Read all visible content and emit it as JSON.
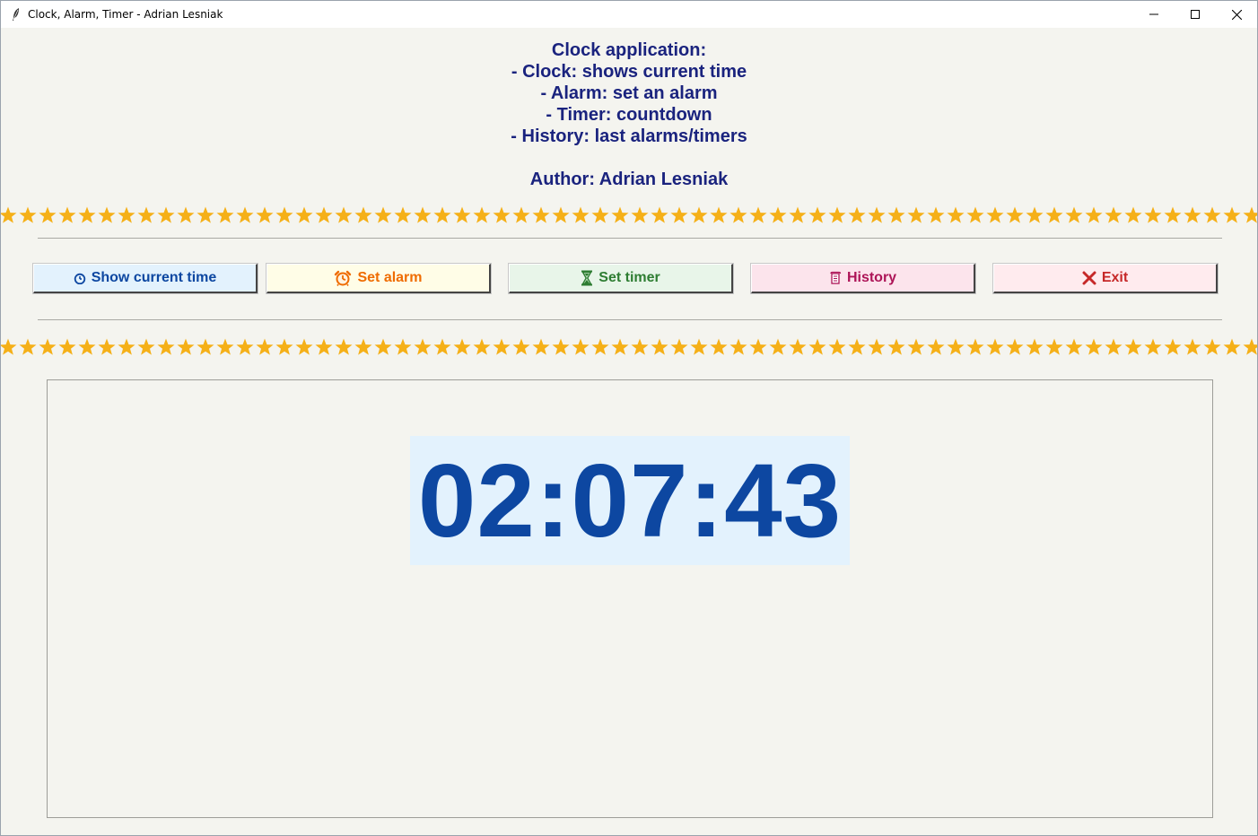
{
  "window": {
    "title": "Clock, Alarm, Timer - Adrian Lesniak",
    "app_icon": "feather-icon",
    "controls": [
      "minimize-icon",
      "maximize-icon",
      "close-icon"
    ]
  },
  "info": {
    "lines": [
      "Clock application:",
      "- Clock: shows current time",
      "- Alarm: set an alarm",
      "- Timer: countdown",
      "- History: last alarms/timers"
    ],
    "author": "Author: Adrian Lesniak"
  },
  "decoration": {
    "star_icon": "star-icon",
    "star_color": "#f5b018"
  },
  "buttons": {
    "show_time": {
      "label": "Show current time",
      "icon": "clock-icon",
      "bg": "#e3f2fd",
      "color": "#0d47a1"
    },
    "set_alarm": {
      "label": "Set alarm",
      "icon": "alarm-clock-icon",
      "bg": "#fffde7",
      "color": "#ef6c00"
    },
    "set_timer": {
      "label": "Set timer",
      "icon": "hourglass-icon",
      "bg": "#e8f5e9",
      "color": "#2e7d32"
    },
    "history": {
      "label": "History",
      "icon": "scroll-icon",
      "bg": "#fce4ec",
      "color": "#ad1457"
    },
    "exit": {
      "label": "Exit",
      "icon": "cross-icon",
      "bg": "#ffebee",
      "color": "#c62828"
    }
  },
  "display": {
    "time": "02:07:43",
    "bg": "#e3f2fd",
    "color": "#0d47a1"
  }
}
